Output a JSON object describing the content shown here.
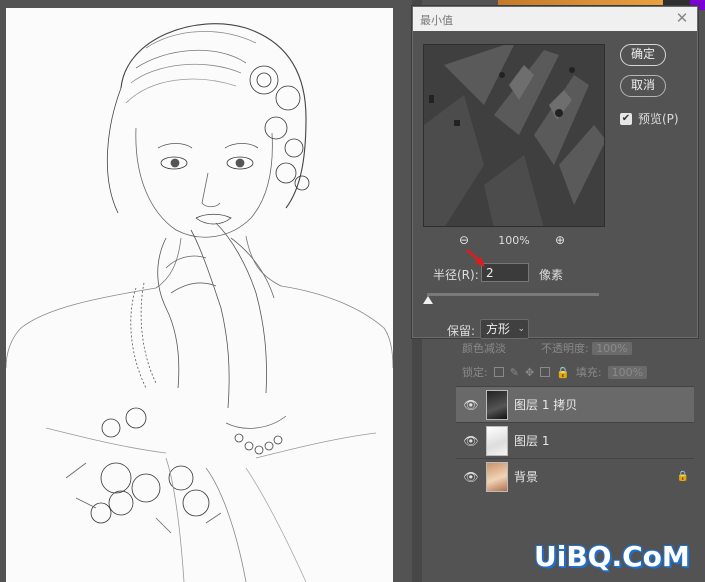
{
  "dialog": {
    "title": "最小值",
    "ok_label": "确定",
    "cancel_label": "取消",
    "preview_label": "预览(P)",
    "preview_checked": true,
    "zoom_value": "100%",
    "radius_label": "半径(R):",
    "radius_value": "2",
    "radius_unit": "像素",
    "preserve_label": "保留:",
    "preserve_value": "方形"
  },
  "layers": {
    "blend_mode": "颜色减淡",
    "opacity_label": "不透明度:",
    "opacity_value": "100%",
    "lock_label": "锁定:",
    "fill_label": "填充:",
    "fill_value": "100%",
    "items": [
      {
        "name": "图层 1 拷贝",
        "thumb": "dark",
        "selected": true,
        "locked": false
      },
      {
        "name": "图层 1",
        "thumb": "light",
        "selected": false,
        "locked": false
      },
      {
        "name": "背景",
        "thumb": "color",
        "selected": false,
        "locked": true
      }
    ]
  },
  "colors": {
    "panel": "#535353",
    "title_bar": "#f0f0f0",
    "selected_layer": "#696969",
    "annotation_arrow": "#e01b1b",
    "watermark_outline": "#1f6fd0"
  },
  "watermark": "UiBQ.CoM"
}
